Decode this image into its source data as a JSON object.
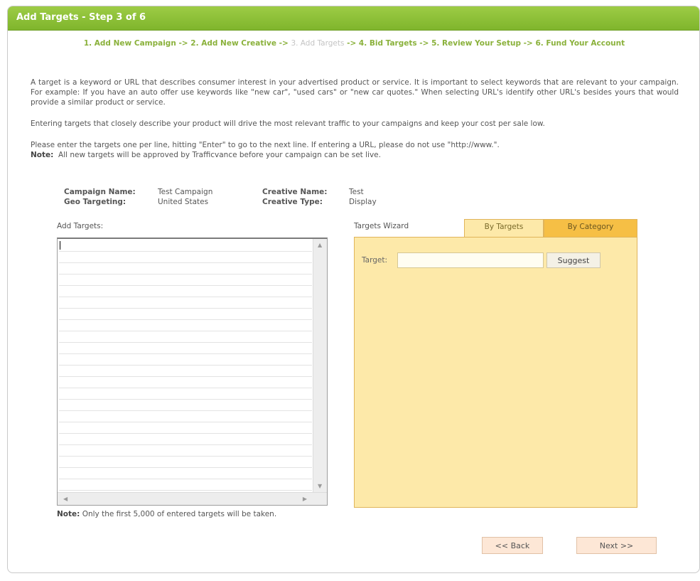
{
  "header": {
    "title": "Add Targets - Step 3 of 6"
  },
  "steps": [
    {
      "label": "1. Add New Campaign",
      "state": "done"
    },
    {
      "label": "2. Add New Creative",
      "state": "done"
    },
    {
      "label": "3. Add Targets",
      "state": "current"
    },
    {
      "label": "4. Bid Targets",
      "state": "todo"
    },
    {
      "label": "5. Review Your Setup",
      "state": "todo"
    },
    {
      "label": "6. Fund Your Account",
      "state": "todo"
    }
  ],
  "step_separator": " -> ",
  "intro": {
    "p1": "A target is a keyword or URL that describes consumer interest in your advertised product or service. It is important to select keywords that are relevant to your campaign. For example: If you have an auto offer use keywords like \"new car\", \"used cars\" or \"new car quotes.\" When selecting URL's identify other URL's besides yours that would provide a similar product or service.",
    "p2": "Entering targets that closely describe your product will drive the most relevant traffic to your campaigns and keep your cost per sale low.",
    "p3": "Please enter the targets one per line, hitting \"Enter\" to go to the next line. If entering a URL, please do not use \"http://www.\".",
    "note_label": "Note:",
    "note_text": "All new targets will be approved by Trafficvance before your campaign can be set live."
  },
  "campaign_info": {
    "campaign_name_label": "Campaign Name:",
    "campaign_name": "Test Campaign",
    "geo_targeting_label": "Geo Targeting:",
    "geo_targeting": "United States",
    "creative_name_label": "Creative Name:",
    "creative_name": "Test",
    "creative_type_label": "Creative Type:",
    "creative_type": "Display"
  },
  "targets_entry": {
    "label": "Add Targets:",
    "value": "",
    "note_label": "Note:",
    "note_text": "Only the first 5,000 of entered targets will be taken."
  },
  "wizard": {
    "label": "Targets Wizard",
    "tabs": [
      "By Targets",
      "By Category"
    ],
    "active_tab": "By Targets",
    "target_label": "Target:",
    "target_value": "",
    "suggest_label": "Suggest"
  },
  "nav": {
    "back_label": "<< Back",
    "next_label": "Next >>"
  },
  "colors": {
    "header_green": "#8bbd36",
    "step_green": "#8ab13b",
    "wizard_yellow": "#fde9a9",
    "tab_orange": "#f6bf45",
    "nav_button_bg": "#fde7d6"
  },
  "icons": {
    "scroll_up": "chevron-up-icon",
    "scroll_down": "chevron-down-icon",
    "scroll_left": "chevron-left-icon",
    "scroll_right": "chevron-right-icon"
  }
}
